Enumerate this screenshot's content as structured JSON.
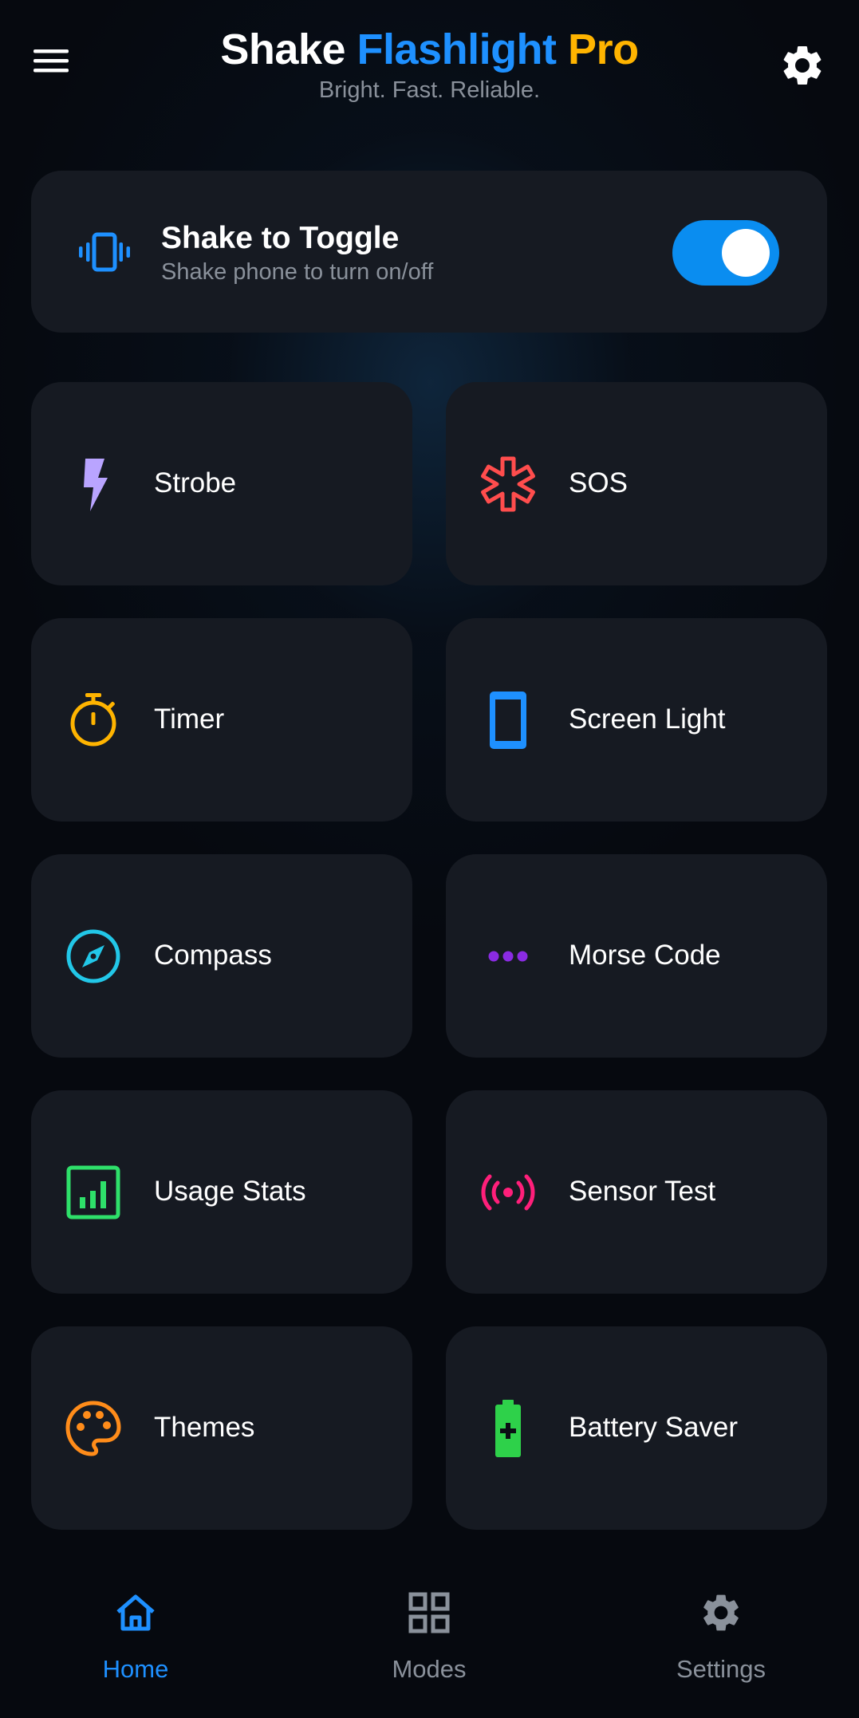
{
  "header": {
    "title_word1": "Shake",
    "title_word2": "Flashlight",
    "title_word3": "Pro",
    "subtitle": "Bright. Fast. Reliable.",
    "menu_icon": "hamburger-menu-icon",
    "settings_icon": "gear-icon"
  },
  "shake_card": {
    "title": "Shake to Toggle",
    "subtitle": "Shake phone to turn on/off",
    "icon": "vibrate-phone-icon",
    "toggle_on": true
  },
  "tiles": [
    {
      "label": "Strobe",
      "icon": "lightning-bolt-icon",
      "color": "#b9a4ff"
    },
    {
      "label": "SOS",
      "icon": "medical-star-icon",
      "color": "#ff4d4d"
    },
    {
      "label": "Timer",
      "icon": "stopwatch-icon",
      "color": "#ffb400"
    },
    {
      "label": "Screen Light",
      "icon": "phone-screen-icon",
      "color": "#1e90ff"
    },
    {
      "label": "Compass",
      "icon": "compass-icon",
      "color": "#22c7e8"
    },
    {
      "label": "Morse Code",
      "icon": "dots-icon",
      "color": "#8a2be2"
    },
    {
      "label": "Usage Stats",
      "icon": "bar-chart-icon",
      "color": "#2ee06a"
    },
    {
      "label": "Sensor Test",
      "icon": "broadcast-icon",
      "color": "#ff1f7a"
    },
    {
      "label": "Themes",
      "icon": "palette-icon",
      "color": "#ff8c1a"
    },
    {
      "label": "Battery Saver",
      "icon": "battery-plus-icon",
      "color": "#2ed14a"
    }
  ],
  "bottom_nav": [
    {
      "label": "Home",
      "icon": "home-icon",
      "active": true
    },
    {
      "label": "Modes",
      "icon": "grid-icon",
      "active": false
    },
    {
      "label": "Settings",
      "icon": "gear-icon",
      "active": false
    }
  ],
  "colors": {
    "accent_blue": "#1e90ff",
    "accent_gold": "#ffb400",
    "card_bg": "#161a22",
    "inactive_gray": "#8a919b"
  }
}
